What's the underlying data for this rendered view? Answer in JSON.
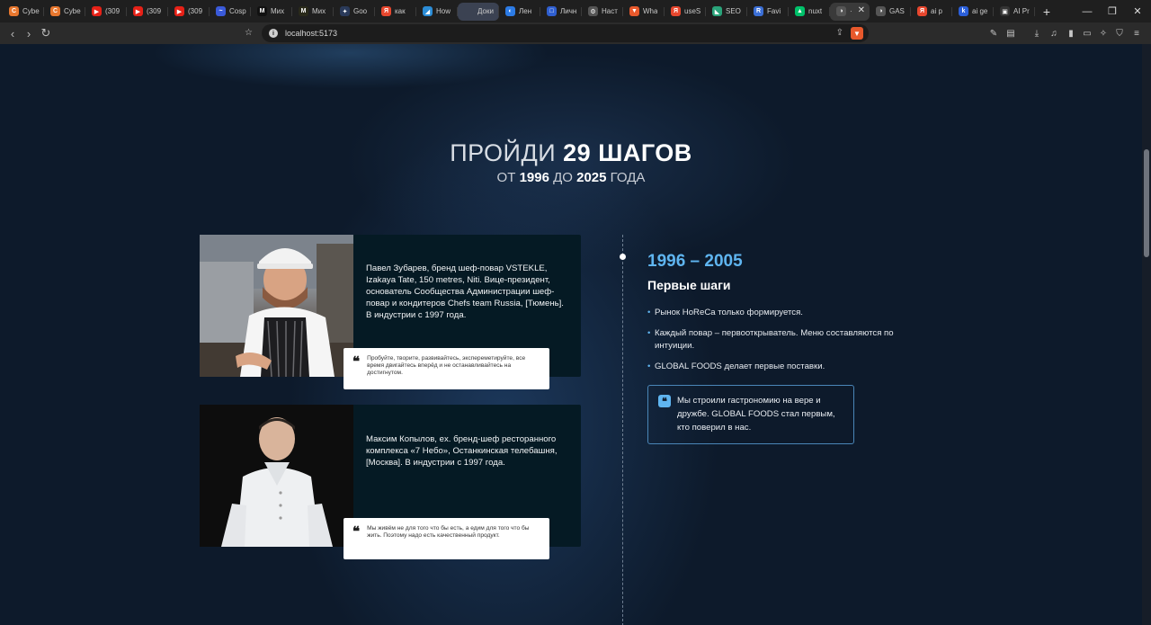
{
  "browser": {
    "tabs": [
      {
        "label": "Cybe",
        "icon": "cybe-favicon",
        "color": "#e8772e",
        "glyph": "C"
      },
      {
        "label": "Cybe",
        "icon": "cybe-favicon",
        "color": "#e8772e",
        "glyph": "C"
      },
      {
        "label": "(309",
        "icon": "youtube-favicon",
        "color": "#e62117",
        "glyph": "▶"
      },
      {
        "label": "(309",
        "icon": "youtube-favicon",
        "color": "#e62117",
        "glyph": "▶"
      },
      {
        "label": "(309",
        "icon": "youtube-favicon",
        "color": "#e62117",
        "glyph": "▶"
      },
      {
        "label": "Cosp",
        "icon": "cosp-favicon",
        "color": "#3a5ad9",
        "glyph": "~"
      },
      {
        "label": "Мих",
        "icon": "mix-favicon",
        "color": "#111111",
        "glyph": "M"
      },
      {
        "label": "Мих",
        "icon": "mix-favicon",
        "color": "#2a2a1a",
        "glyph": "M"
      },
      {
        "label": "Goo",
        "icon": "gemini-favicon",
        "color": "#2a3a5a",
        "glyph": "✦"
      },
      {
        "label": "как",
        "icon": "yandex-favicon",
        "color": "#e8472e",
        "glyph": "Я"
      },
      {
        "label": "How",
        "icon": "how-favicon",
        "color": "#2b8cd6",
        "glyph": "◢"
      },
      {
        "label": "Доки",
        "icon": "docs-favicon",
        "color": "#3b4252",
        "glyph": ""
      },
      {
        "label": "Лен",
        "icon": "lenta-favicon",
        "color": "#2c7be5",
        "glyph": "◐"
      },
      {
        "label": "Личн",
        "icon": "folder-favicon",
        "color": "#2f5fd0",
        "glyph": "□"
      },
      {
        "label": "Наст",
        "icon": "settings-favicon",
        "color": "#555555",
        "glyph": "⚙"
      },
      {
        "label": "Wha",
        "icon": "brave-favicon",
        "color": "#e8592c",
        "glyph": "▼"
      },
      {
        "label": "useS",
        "icon": "yandex-favicon",
        "color": "#e8472e",
        "glyph": "Я"
      },
      {
        "label": "SEO",
        "icon": "seo-favicon",
        "color": "#2aa37a",
        "glyph": "◣"
      },
      {
        "label": "Favi",
        "icon": "favi-favicon",
        "color": "#3b6fd6",
        "glyph": "R"
      },
      {
        "label": "nuxt",
        "icon": "nuxt-favicon",
        "color": "#00c16a",
        "glyph": "▲"
      },
      {
        "label": "·",
        "icon": "active-favicon",
        "color": "#555555",
        "glyph": "◑"
      },
      {
        "label": "GAS",
        "icon": "gas-favicon",
        "color": "#555555",
        "glyph": "◑"
      },
      {
        "label": "ai р",
        "icon": "yandex-favicon",
        "color": "#e8472e",
        "glyph": "Я"
      },
      {
        "label": "ai ge",
        "icon": "k-favicon",
        "color": "#2b5fd9",
        "glyph": "k"
      },
      {
        "label": "AI Pr",
        "icon": "aipr-favicon",
        "color": "#333333",
        "glyph": "▣"
      }
    ],
    "active_close": "✕",
    "new_tab": "+",
    "url": "localhost:5173"
  },
  "hero": {
    "title_prefix": "ПРОЙДИ",
    "title_bold": "29 ШАГОВ",
    "sub_from": "ОТ",
    "sub_start": "1996",
    "sub_to": "ДО",
    "sub_end": "2025",
    "sub_suffix": "ГОДА"
  },
  "chefs": [
    {
      "bio": "Павел Зубарев, бренд шеф-повар VSTEKLE, Izakaya Tate, 150 metres, Niti. Вице-президент, основатель Сообщества Администрации шеф-повар и кондитеров Chefs team Russia, [Тюмень]. В индустрии с 1997 года.",
      "quote": "Пробуйте, творите, развивайтесь, экспереметируйте, все время двигайтесь вперёд и не останавливайтесь на достигнутом."
    },
    {
      "bio": "Максим Копылов, ex. бренд-шеф ресторанного комплекса «7 Небо», Останкинская телебашня, [Москва]. В индустрии с 1997 года.",
      "quote": "Мы живём не для того что бы есть, а едим для того что бы жить. Поэтому надо есть качественный продукт."
    }
  ],
  "timeline": {
    "era": "1996 – 2005",
    "title": "Первые шаги",
    "facts": [
      "Рынок HoReCa только формируется.",
      "Каждый повар – первооткрыватель. Меню составляются по интуиции.",
      "GLOBAL FOODS делает первые поставки."
    ],
    "quote": "Мы строили гастрономию на вере и дружбе. GLOBAL FOODS стал первым, кто поверил в нас."
  },
  "colors": {
    "background": "#0d1a2b",
    "accent": "#5fb5f0",
    "card": "#051a24"
  }
}
